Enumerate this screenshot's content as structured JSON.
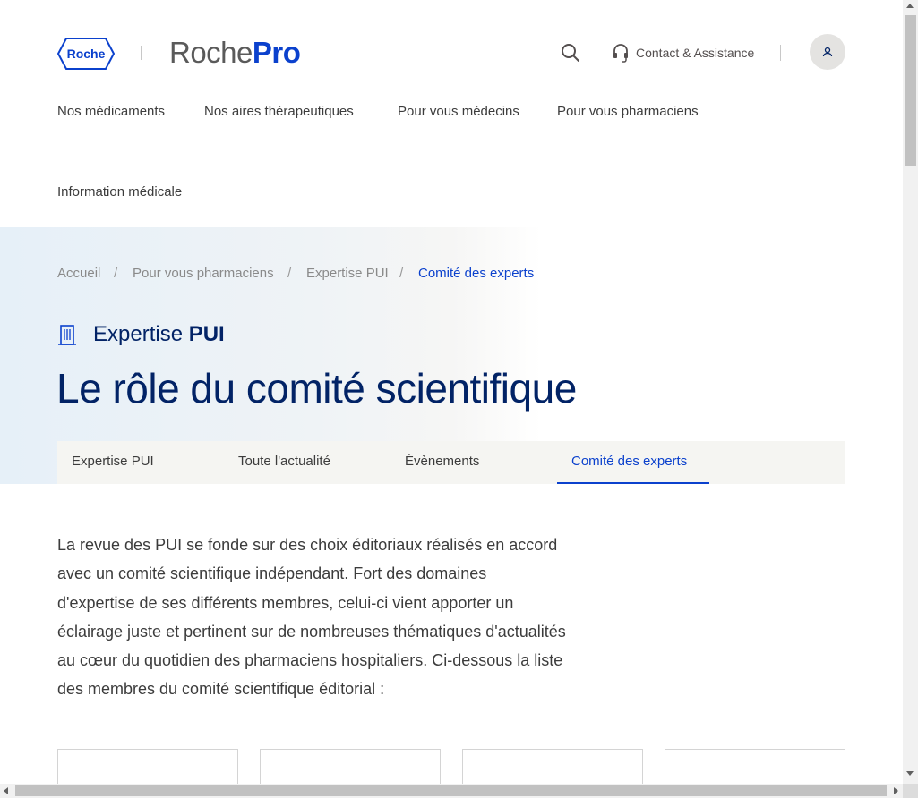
{
  "header": {
    "logo_text": "Roche",
    "brand_primary": "Roche",
    "brand_secondary": "Pro",
    "contact_label": "Contact & Assistance",
    "search_icon": "search-icon",
    "contact_icon": "headset-icon",
    "account_icon": "user-icon"
  },
  "nav": {
    "items": [
      {
        "label": "Nos médicaments"
      },
      {
        "label": "Nos aires thérapeutiques"
      },
      {
        "label": "Pour vous médecins"
      },
      {
        "label": "Pour vous pharmaciens"
      },
      {
        "label": "Information médicale"
      }
    ]
  },
  "breadcrumb": {
    "items": [
      {
        "label": "Accueil"
      },
      {
        "label": "Pour vous pharmaciens"
      },
      {
        "label": "Expertise PUI"
      },
      {
        "label": "Comité des experts"
      }
    ],
    "separator": "/"
  },
  "section": {
    "icon": "building-icon",
    "title_part1": "Expertise",
    "title_part2": "PUI"
  },
  "page": {
    "title": "Le rôle du comité scientifique",
    "intro": "La revue des PUI se fonde sur des choix éditoriaux réalisés en accord avec un comité scientifique indépendant. Fort des domaines d'expertise de ses différents membres, celui-ci vient apporter un éclairage juste et pertinent sur de nombreuses thématiques d'actualités au cœur du quotidien des pharmaciens hospitaliers. Ci-dessous la liste des membres du comité scientifique éditorial :"
  },
  "tabs": [
    {
      "label": "Expertise PUI"
    },
    {
      "label": "Toute l'actualité"
    },
    {
      "label": "Évènements"
    },
    {
      "label": "Comité des experts",
      "active": true
    }
  ],
  "colors": {
    "brand_blue": "#0b41cd",
    "navy": "#022366",
    "text": "#3c3c3c",
    "muted": "#8a8a8a",
    "tab_bg": "#f5f5f2"
  }
}
